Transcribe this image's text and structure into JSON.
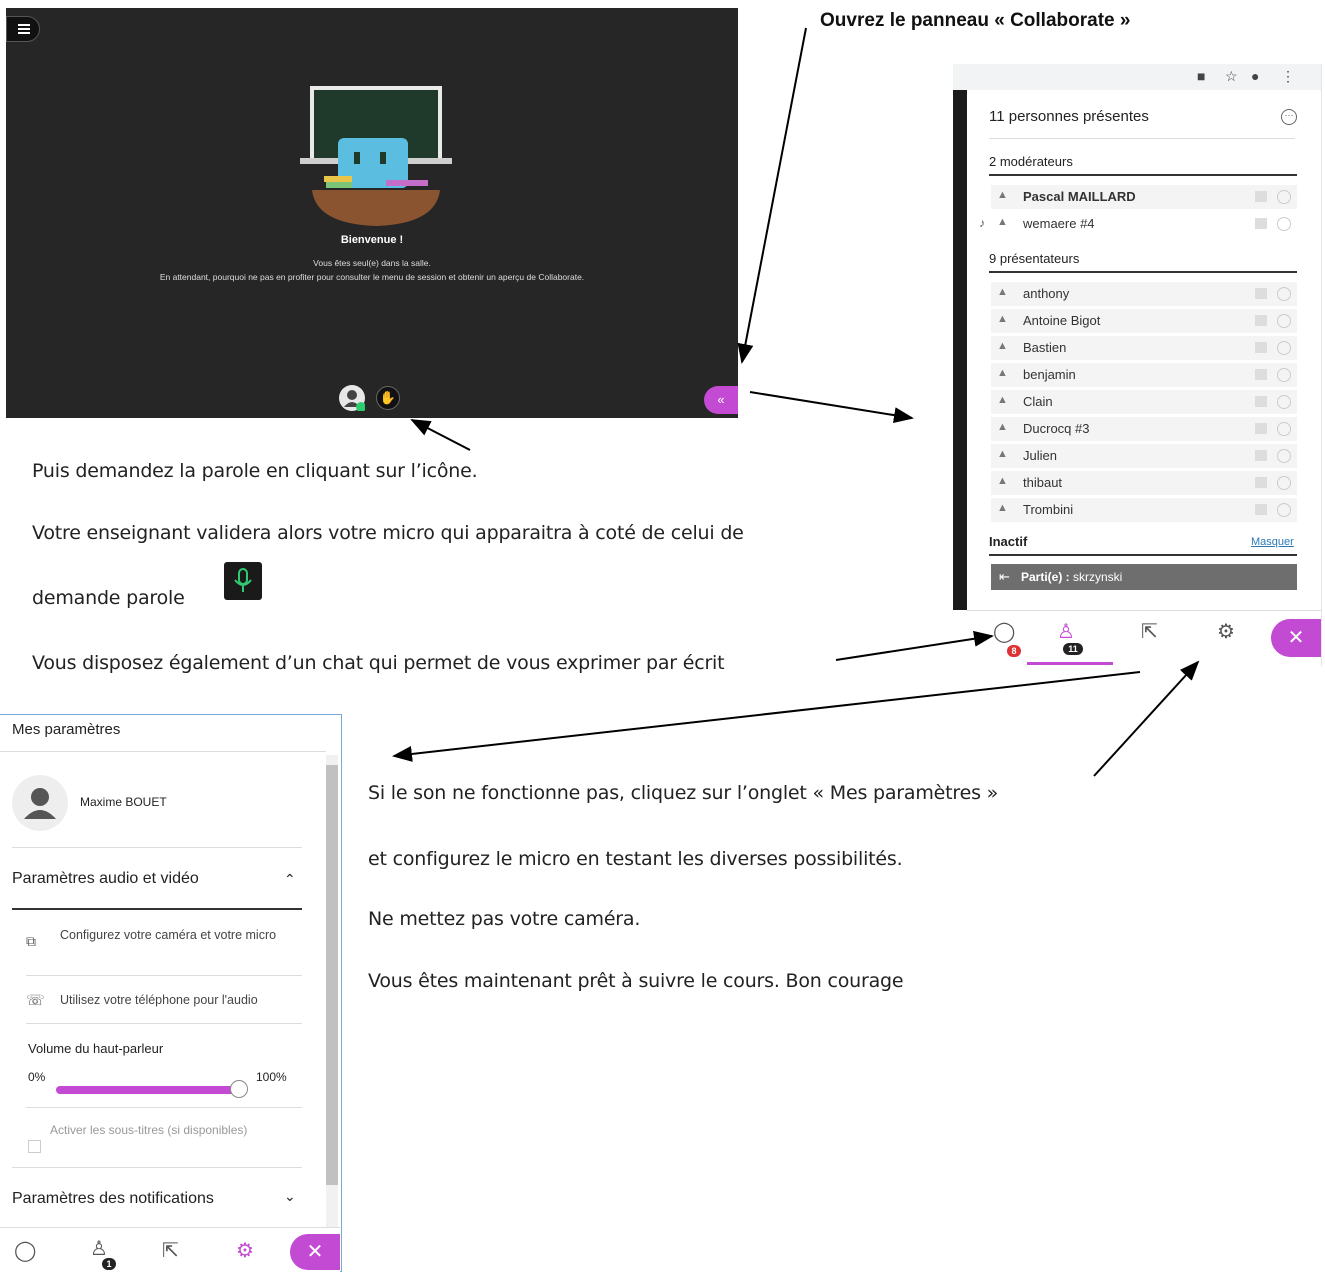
{
  "headline": "Ouvrez le panneau « Collaborate »",
  "session": {
    "welcome_title": "Bienvenue !",
    "welcome_line1": "Vous êtes seul(e) dans la salle.",
    "welcome_line2": "En attendant, pourquoi ne pas en profiter pour consulter le menu de session et obtenir un aperçu de Collaborate."
  },
  "participants_panel": {
    "count_title": "11 personnes présentes",
    "moderators_title": "2 modérateurs",
    "moderators": [
      "Pascal MAILLARD",
      "wemaere #4"
    ],
    "presenters_title": "9 présentateurs",
    "presenters": [
      "anthony",
      "Antoine Bigot",
      "Bastien",
      "benjamin",
      "Clain",
      "Ducrocq #3",
      "Julien",
      "thibaut",
      "Trombini"
    ],
    "inactive_title": "Inactif",
    "hide_link": "Masquer",
    "left_label": "Parti(e) : ",
    "left_name": "skrzynski",
    "chat_badge": "8",
    "participants_badge": "11"
  },
  "instructions": {
    "line1": "Puis demandez la parole en cliquant sur l’icône.",
    "line2": "Votre enseignant validera alors votre micro qui apparaitra à coté de celui de",
    "line3": "demande parole",
    "line4": "Vous disposez également d’un chat qui permet de vous exprimer par écrit",
    "settings_line1": "Si le son ne fonctionne pas, cliquez sur l’onglet « Mes paramètres »",
    "settings_line2": "et configurez le micro en testant les diverses possibilités.",
    "settings_line3": "Ne mettez pas votre caméra.",
    "settings_line4": "Vous êtes maintenant prêt à suivre le cours. Bon courage"
  },
  "settings_panel": {
    "title": "Mes paramètres",
    "user_name": "Maxime BOUET",
    "audio_video_header": "Paramètres audio et vidéo",
    "camera_item": "Configurez votre caméra et votre micro",
    "phone_item": "Utilisez votre téléphone pour l'audio",
    "volume_label": "Volume du haut-parleur",
    "volume_min": "0%",
    "volume_max": "100%",
    "volume_level": 1.0,
    "subtitles_item": "Activer les sous-titres (si disponibles)",
    "notifications_header": "Paramètres des notifications",
    "participants_badge": "1"
  },
  "colors": {
    "accent": "#c34ad3",
    "session_bg": "#262626",
    "mic_green": "#2ecc71"
  }
}
